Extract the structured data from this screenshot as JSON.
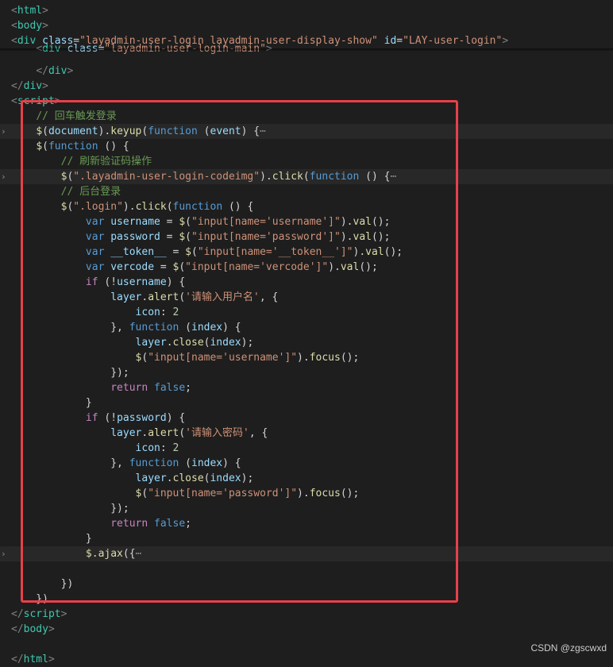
{
  "editor": {
    "lines": [
      [
        [
          "tok-punc",
          "<"
        ],
        [
          "tok-tag",
          "html"
        ],
        [
          "tok-punc",
          ">"
        ]
      ],
      [
        [
          "tok-punc",
          "<"
        ],
        [
          "tok-tag",
          "body"
        ],
        [
          "tok-punc",
          ">"
        ]
      ],
      [
        [
          "tok-punc",
          "<"
        ],
        [
          "tok-tag",
          "div"
        ],
        [
          "tok-dim",
          " "
        ],
        [
          "tok-attr",
          "class"
        ],
        [
          "tok-dim",
          "="
        ],
        [
          "tok-str",
          "\"layadmin-user-login layadmin-user-display-show\""
        ],
        [
          "tok-dim",
          " "
        ],
        [
          "tok-attr",
          "id"
        ],
        [
          "tok-dim",
          "="
        ],
        [
          "tok-str",
          "\"LAY-user-login\""
        ],
        [
          "tok-punc",
          ">"
        ]
      ],
      [
        [
          "tok-dim",
          "    "
        ],
        [
          "tok-punc",
          "<"
        ],
        [
          "tok-tag",
          "div"
        ],
        [
          "tok-dim",
          " "
        ],
        [
          "tok-attr",
          "class"
        ],
        [
          "tok-dim",
          "="
        ],
        [
          "tok-str",
          "\"layadmin-user-login-main\""
        ],
        [
          "tok-punc",
          ">"
        ]
      ],
      [
        [
          "tok-dim",
          "    "
        ],
        [
          "tok-punc",
          "</"
        ],
        [
          "tok-tag",
          "div"
        ],
        [
          "tok-punc",
          ">"
        ]
      ],
      [
        [
          "tok-punc",
          "</"
        ],
        [
          "tok-tag",
          "div"
        ],
        [
          "tok-punc",
          ">"
        ]
      ],
      [
        [
          "tok-punc",
          "<"
        ],
        [
          "tok-tag",
          "script"
        ],
        [
          "tok-punc",
          ">"
        ]
      ],
      [
        [
          "tok-dim",
          "    "
        ],
        [
          "tok-cmt",
          "// 回车触发登录"
        ]
      ],
      [
        [
          "tok-dim",
          "    "
        ],
        [
          "tok-fn",
          "$"
        ],
        [
          "tok-dim",
          "("
        ],
        [
          "tok-var",
          "document"
        ],
        [
          "tok-dim",
          ")."
        ],
        [
          "tok-fn",
          "keyup"
        ],
        [
          "tok-dim",
          "("
        ],
        [
          "tok-kw",
          "function"
        ],
        [
          "tok-dim",
          " ("
        ],
        [
          "tok-var",
          "event"
        ],
        [
          "tok-dim",
          ") {"
        ],
        [
          "tok-dots",
          "⋯"
        ]
      ],
      [
        [
          "tok-dim",
          "    "
        ],
        [
          "tok-fn",
          "$"
        ],
        [
          "tok-dim",
          "("
        ],
        [
          "tok-kw",
          "function"
        ],
        [
          "tok-dim",
          " () {"
        ]
      ],
      [
        [
          "tok-dim",
          "        "
        ],
        [
          "tok-cmt",
          "// 刷新验证码操作"
        ]
      ],
      [
        [
          "tok-dim",
          "        "
        ],
        [
          "tok-fn",
          "$"
        ],
        [
          "tok-dim",
          "("
        ],
        [
          "tok-str",
          "\".layadmin-user-login-codeimg\""
        ],
        [
          "tok-dim",
          ")."
        ],
        [
          "tok-fn",
          "click"
        ],
        [
          "tok-dim",
          "("
        ],
        [
          "tok-kw",
          "function"
        ],
        [
          "tok-dim",
          " () {"
        ],
        [
          "tok-dots",
          "⋯"
        ]
      ],
      [
        [
          "tok-dim",
          "        "
        ],
        [
          "tok-cmt",
          "// 后台登录"
        ]
      ],
      [
        [
          "tok-dim",
          "        "
        ],
        [
          "tok-fn",
          "$"
        ],
        [
          "tok-dim",
          "("
        ],
        [
          "tok-str",
          "\".login\""
        ],
        [
          "tok-dim",
          ")."
        ],
        [
          "tok-fn",
          "click"
        ],
        [
          "tok-dim",
          "("
        ],
        [
          "tok-kw",
          "function"
        ],
        [
          "tok-dim",
          " () {"
        ]
      ],
      [
        [
          "tok-dim",
          "            "
        ],
        [
          "tok-kw",
          "var"
        ],
        [
          "tok-dim",
          " "
        ],
        [
          "tok-var",
          "username"
        ],
        [
          "tok-dim",
          " = "
        ],
        [
          "tok-fn",
          "$"
        ],
        [
          "tok-dim",
          "("
        ],
        [
          "tok-str",
          "\"input[name='username']\""
        ],
        [
          "tok-dim",
          ")."
        ],
        [
          "tok-fn",
          "val"
        ],
        [
          "tok-dim",
          "();"
        ]
      ],
      [
        [
          "tok-dim",
          "            "
        ],
        [
          "tok-kw",
          "var"
        ],
        [
          "tok-dim",
          " "
        ],
        [
          "tok-var",
          "password"
        ],
        [
          "tok-dim",
          " = "
        ],
        [
          "tok-fn",
          "$"
        ],
        [
          "tok-dim",
          "("
        ],
        [
          "tok-str",
          "\"input[name='password']\""
        ],
        [
          "tok-dim",
          ")."
        ],
        [
          "tok-fn",
          "val"
        ],
        [
          "tok-dim",
          "();"
        ]
      ],
      [
        [
          "tok-dim",
          "            "
        ],
        [
          "tok-kw",
          "var"
        ],
        [
          "tok-dim",
          " "
        ],
        [
          "tok-var",
          "__token__"
        ],
        [
          "tok-dim",
          " = "
        ],
        [
          "tok-fn",
          "$"
        ],
        [
          "tok-dim",
          "("
        ],
        [
          "tok-str",
          "\"input[name='__token__']\""
        ],
        [
          "tok-dim",
          ")."
        ],
        [
          "tok-fn",
          "val"
        ],
        [
          "tok-dim",
          "();"
        ]
      ],
      [
        [
          "tok-dim",
          "            "
        ],
        [
          "tok-kw",
          "var"
        ],
        [
          "tok-dim",
          " "
        ],
        [
          "tok-var",
          "vercode"
        ],
        [
          "tok-dim",
          " = "
        ],
        [
          "tok-fn",
          "$"
        ],
        [
          "tok-dim",
          "("
        ],
        [
          "tok-str",
          "\"input[name='vercode']\""
        ],
        [
          "tok-dim",
          ")."
        ],
        [
          "tok-fn",
          "val"
        ],
        [
          "tok-dim",
          "();"
        ]
      ],
      [
        [
          "tok-dim",
          "            "
        ],
        [
          "tok-ctrl",
          "if"
        ],
        [
          "tok-dim",
          " (!"
        ],
        [
          "tok-var",
          "username"
        ],
        [
          "tok-dim",
          ") {"
        ]
      ],
      [
        [
          "tok-dim",
          "                "
        ],
        [
          "tok-var",
          "layer"
        ],
        [
          "tok-dim",
          "."
        ],
        [
          "tok-fn",
          "alert"
        ],
        [
          "tok-dim",
          "("
        ],
        [
          "tok-sstr",
          "'请输入用户名'"
        ],
        [
          "tok-dim",
          ", {"
        ]
      ],
      [
        [
          "tok-dim",
          "                    "
        ],
        [
          "tok-var",
          "icon"
        ],
        [
          "tok-dim",
          ": "
        ],
        [
          "tok-num",
          "2"
        ]
      ],
      [
        [
          "tok-dim",
          "                }, "
        ],
        [
          "tok-kw",
          "function"
        ],
        [
          "tok-dim",
          " ("
        ],
        [
          "tok-var",
          "index"
        ],
        [
          "tok-dim",
          ") {"
        ]
      ],
      [
        [
          "tok-dim",
          "                    "
        ],
        [
          "tok-var",
          "layer"
        ],
        [
          "tok-dim",
          "."
        ],
        [
          "tok-fn",
          "close"
        ],
        [
          "tok-dim",
          "("
        ],
        [
          "tok-var",
          "index"
        ],
        [
          "tok-dim",
          ");"
        ]
      ],
      [
        [
          "tok-dim",
          "                    "
        ],
        [
          "tok-fn",
          "$"
        ],
        [
          "tok-dim",
          "("
        ],
        [
          "tok-str",
          "\"input[name='username']\""
        ],
        [
          "tok-dim",
          ")."
        ],
        [
          "tok-fn",
          "focus"
        ],
        [
          "tok-dim",
          "();"
        ]
      ],
      [
        [
          "tok-dim",
          "                });"
        ]
      ],
      [
        [
          "tok-dim",
          "                "
        ],
        [
          "tok-ctrl",
          "return"
        ],
        [
          "tok-dim",
          " "
        ],
        [
          "tok-kw",
          "false"
        ],
        [
          "tok-dim",
          ";"
        ]
      ],
      [
        [
          "tok-dim",
          "            }"
        ]
      ],
      [
        [
          "tok-dim",
          "            "
        ],
        [
          "tok-ctrl",
          "if"
        ],
        [
          "tok-dim",
          " (!"
        ],
        [
          "tok-var",
          "password"
        ],
        [
          "tok-dim",
          ") {"
        ]
      ],
      [
        [
          "tok-dim",
          "                "
        ],
        [
          "tok-var",
          "layer"
        ],
        [
          "tok-dim",
          "."
        ],
        [
          "tok-fn",
          "alert"
        ],
        [
          "tok-dim",
          "("
        ],
        [
          "tok-sstr",
          "'请输入密码'"
        ],
        [
          "tok-dim",
          ", {"
        ]
      ],
      [
        [
          "tok-dim",
          "                    "
        ],
        [
          "tok-var",
          "icon"
        ],
        [
          "tok-dim",
          ": "
        ],
        [
          "tok-num",
          "2"
        ]
      ],
      [
        [
          "tok-dim",
          "                }, "
        ],
        [
          "tok-kw",
          "function"
        ],
        [
          "tok-dim",
          " ("
        ],
        [
          "tok-var",
          "index"
        ],
        [
          "tok-dim",
          ") {"
        ]
      ],
      [
        [
          "tok-dim",
          "                    "
        ],
        [
          "tok-var",
          "layer"
        ],
        [
          "tok-dim",
          "."
        ],
        [
          "tok-fn",
          "close"
        ],
        [
          "tok-dim",
          "("
        ],
        [
          "tok-var",
          "index"
        ],
        [
          "tok-dim",
          ");"
        ]
      ],
      [
        [
          "tok-dim",
          "                    "
        ],
        [
          "tok-fn",
          "$"
        ],
        [
          "tok-dim",
          "("
        ],
        [
          "tok-str",
          "\"input[name='password']\""
        ],
        [
          "tok-dim",
          ")."
        ],
        [
          "tok-fn",
          "focus"
        ],
        [
          "tok-dim",
          "();"
        ]
      ],
      [
        [
          "tok-dim",
          "                });"
        ]
      ],
      [
        [
          "tok-dim",
          "                "
        ],
        [
          "tok-ctrl",
          "return"
        ],
        [
          "tok-dim",
          " "
        ],
        [
          "tok-kw",
          "false"
        ],
        [
          "tok-dim",
          ";"
        ]
      ],
      [
        [
          "tok-dim",
          "            }"
        ]
      ],
      [
        [
          "tok-dim",
          "            "
        ],
        [
          "tok-fn",
          "$"
        ],
        [
          "tok-dim",
          "."
        ],
        [
          "tok-fn",
          "ajax"
        ],
        [
          "tok-dim",
          "({"
        ],
        [
          "tok-dots",
          "⋯"
        ]
      ],
      [],
      [
        [
          "tok-dim",
          "        })"
        ]
      ],
      [
        [
          "tok-dim",
          "    })"
        ]
      ],
      [
        [
          "tok-punc",
          "</"
        ],
        [
          "tok-tag",
          "script"
        ],
        [
          "tok-punc",
          ">"
        ]
      ],
      [
        [
          "tok-punc",
          "</"
        ],
        [
          "tok-tag",
          "body"
        ],
        [
          "tok-punc",
          ">"
        ]
      ],
      [],
      [
        [
          "tok-punc",
          "</"
        ],
        [
          "tok-tag",
          "html"
        ],
        [
          "tok-punc",
          ">"
        ]
      ]
    ],
    "folded_lines": [
      8,
      11,
      36
    ],
    "highlighted_lines": [
      8,
      11,
      36
    ]
  },
  "watermark": "CSDN @zgscwxd",
  "highlight_box_color": "#e8404a"
}
